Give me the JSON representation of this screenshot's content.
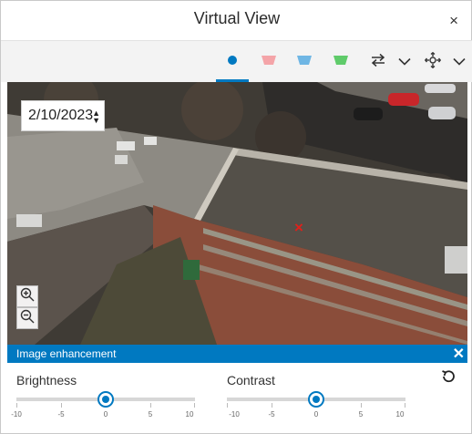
{
  "window": {
    "title": "Virtual View",
    "close_glyph": "×"
  },
  "toolbar": {
    "tools": [
      {
        "name": "camera-point-icon",
        "color": "#0079c1",
        "active": true
      },
      {
        "name": "view-cone-red-icon",
        "color": "#f4a4a8",
        "active": false
      },
      {
        "name": "view-cone-blue-icon",
        "color": "#6fb6e4",
        "active": false
      },
      {
        "name": "view-cone-green-icon",
        "color": "#5fcb6a",
        "active": false
      }
    ],
    "swap_icon": "arrows-exchange-icon",
    "move_icon": "move-crosshair-icon",
    "dropdown_icon": "chevron-down-icon"
  },
  "viewer": {
    "date": "2/10/2023",
    "marker": "×",
    "marker_color": "#e0201a"
  },
  "enhancement": {
    "title": "Image enhancement",
    "close_glyph": "✕",
    "sliders": [
      {
        "label": "Brightness",
        "value": 0,
        "min": -10,
        "max": 10,
        "ticks": [
          "-10",
          "-5",
          "0",
          "5",
          "10"
        ]
      },
      {
        "label": "Contrast",
        "value": 0,
        "min": -10,
        "max": 10,
        "ticks": [
          "-10",
          "-5",
          "0",
          "5",
          "10"
        ]
      }
    ],
    "reset_icon": "reset-undo-icon"
  },
  "colors": {
    "accent": "#0079c1",
    "toolbar_bg": "#f3f3f3"
  }
}
